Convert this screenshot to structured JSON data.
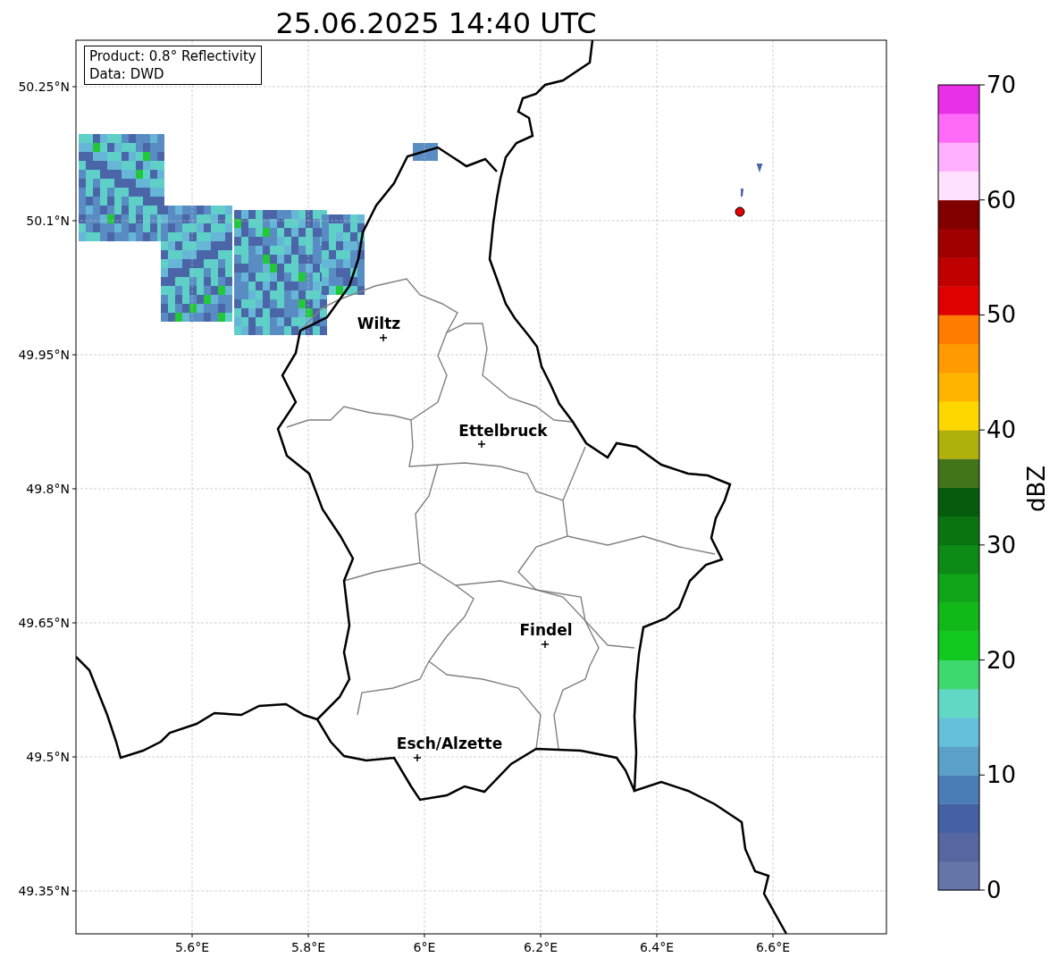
{
  "title": "25.06.2025 14:40 UTC",
  "map": {
    "info_box": [
      "Product: 0.8° Reflectivity",
      "Data: DWD"
    ],
    "cities": [
      {
        "name": "Wiltz"
      },
      {
        "name": "Ettelbruck"
      },
      {
        "name": "Findel"
      },
      {
        "name": "Esch/Alzette"
      }
    ],
    "y_ticks": [
      "50.25°N",
      "50.1°N",
      "49.95°N",
      "49.8°N",
      "49.65°N",
      "49.5°N",
      "49.35°N"
    ],
    "x_ticks": [
      "5.6°E",
      "5.8°E",
      "6°E",
      "6.2°E",
      "6.4°E",
      "6.6°E"
    ]
  },
  "colorbar": {
    "label": "dBZ",
    "ticks": [
      "70",
      "60",
      "50",
      "40",
      "30",
      "20",
      "10",
      "0"
    ],
    "bands": [
      {
        "color": "#6675a8"
      },
      {
        "color": "#5566a0"
      },
      {
        "color": "#4560a3"
      },
      {
        "color": "#4a7db5"
      },
      {
        "color": "#5aa0c8"
      },
      {
        "color": "#65c0dc"
      },
      {
        "color": "#60d8c4"
      },
      {
        "color": "#3dd86e"
      },
      {
        "color": "#10c820"
      },
      {
        "color": "#10b818"
      },
      {
        "color": "#10a418"
      },
      {
        "color": "#0e8a16"
      },
      {
        "color": "#0b7412"
      },
      {
        "color": "#065c0c"
      },
      {
        "color": "#42751a"
      },
      {
        "color": "#b0b00a"
      },
      {
        "color": "#ffd700"
      },
      {
        "color": "#ffb400"
      },
      {
        "color": "#ff9a00"
      },
      {
        "color": "#ff7c00"
      },
      {
        "color": "#e00000"
      },
      {
        "color": "#c00000"
      },
      {
        "color": "#a00000"
      },
      {
        "color": "#800000"
      },
      {
        "color": "#ffe0ff"
      },
      {
        "color": "#ffb0ff"
      },
      {
        "color": "#ff6af8"
      },
      {
        "color": "#e830e8"
      }
    ]
  }
}
